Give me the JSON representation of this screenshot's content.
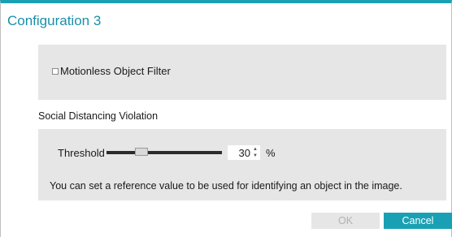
{
  "dialog": {
    "title": "Configuration 3",
    "accent_color": "#1aa0b4"
  },
  "motionless_filter": {
    "label": "Motionless Object Filter",
    "checked": false
  },
  "social_distancing": {
    "section_label": "Social Distancing Violation",
    "threshold_label": "Threshold",
    "threshold_slider_fraction": 0.3,
    "threshold_value": "30",
    "spin_up_glyph": "▲",
    "spin_down_glyph": "▼",
    "unit": "%",
    "hint": "You can set a reference value to be used for identifying an object in the image."
  },
  "buttons": {
    "ok_label": "OK",
    "ok_enabled": false,
    "cancel_label": "Cancel"
  },
  "icons": {
    "spin_up": "chevron-up-icon",
    "spin_down": "chevron-down-icon"
  }
}
